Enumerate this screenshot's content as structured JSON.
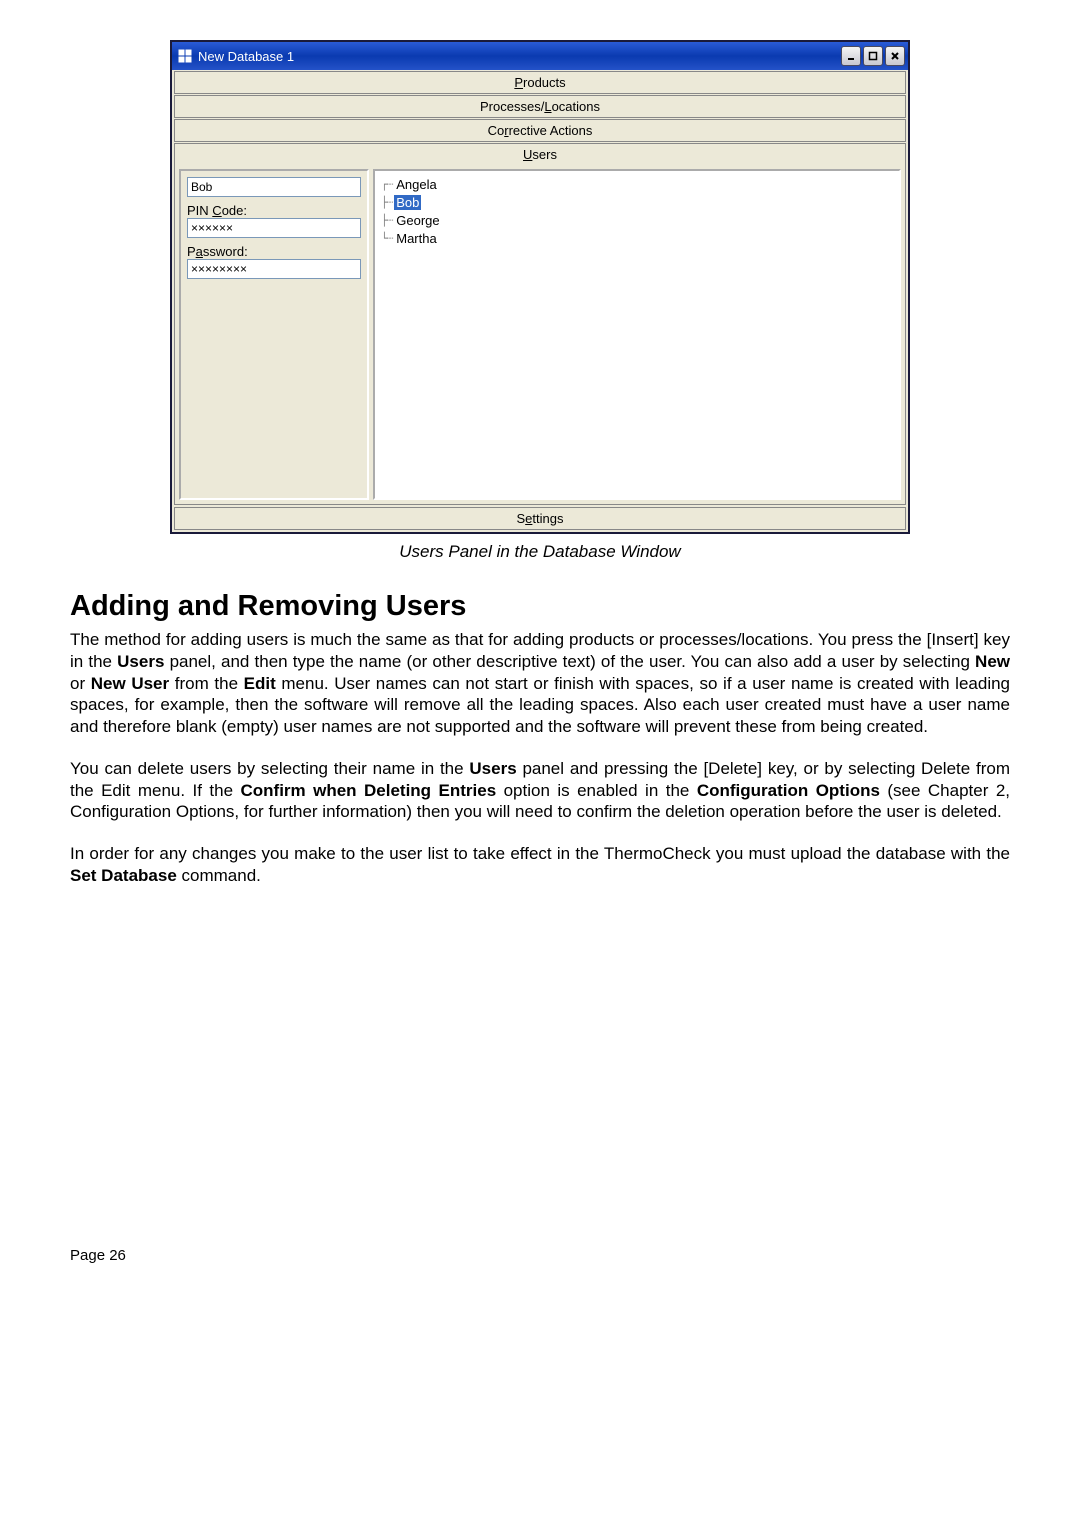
{
  "window": {
    "title": "New Database 1",
    "tabs": {
      "products": "Products",
      "processes": "Processes/Locations",
      "corrective": "Corrective Actions",
      "users": "Users",
      "settings": "Settings"
    },
    "form": {
      "name_value": "Bob",
      "pin_label": "PIN Code:",
      "pin_value": "××××××",
      "password_label": "Password:",
      "password_value": "××××××××"
    },
    "tree": {
      "items": [
        "Angela",
        "Bob",
        "George",
        "Martha"
      ],
      "selected_index": 1
    }
  },
  "caption": "Users Panel in the Database Window",
  "heading": "Adding and Removing Users",
  "para1": "The method for adding users is much the same as that for adding products or processes/locations. You press the [Insert] key in the ",
  "para1_b1": "Users",
  "para1_mid1": " panel, and then type the name (or other descriptive text) of the user.  You can also add a user by selecting ",
  "para1_b2": "New",
  "para1_mid2": " or ",
  "para1_b3": "New User",
  "para1_mid3": " from the ",
  "para1_b4": "Edit",
  "para1_end": " menu.  User names can not start or finish with spaces, so if a user name is created with leading spaces, for example, then the software will remove all the leading spaces.  Also each user created must have a user name and therefore blank (empty) user names are not supported and the software will prevent these from being created.",
  "para2_a": "You can delete users by selecting their name in the ",
  "para2_b1": "Users",
  "para2_b": " panel and pressing the [Delete] key, or by selecting Delete from the Edit menu.  If the ",
  "para2_b2": "Confirm when Deleting Entries",
  "para2_c": " option is enabled in the ",
  "para2_b3": "Configuration Options",
  "para2_d": " (see Chapter 2, Configuration Options, for further information) then you will need to confirm the deletion operation before the user is deleted.",
  "para3_a": "In order for any changes you make to the user list to take effect in the ThermoCheck you must upload the database with the ",
  "para3_b1": "Set Database",
  "para3_b": " command.",
  "footer": "Page 26"
}
